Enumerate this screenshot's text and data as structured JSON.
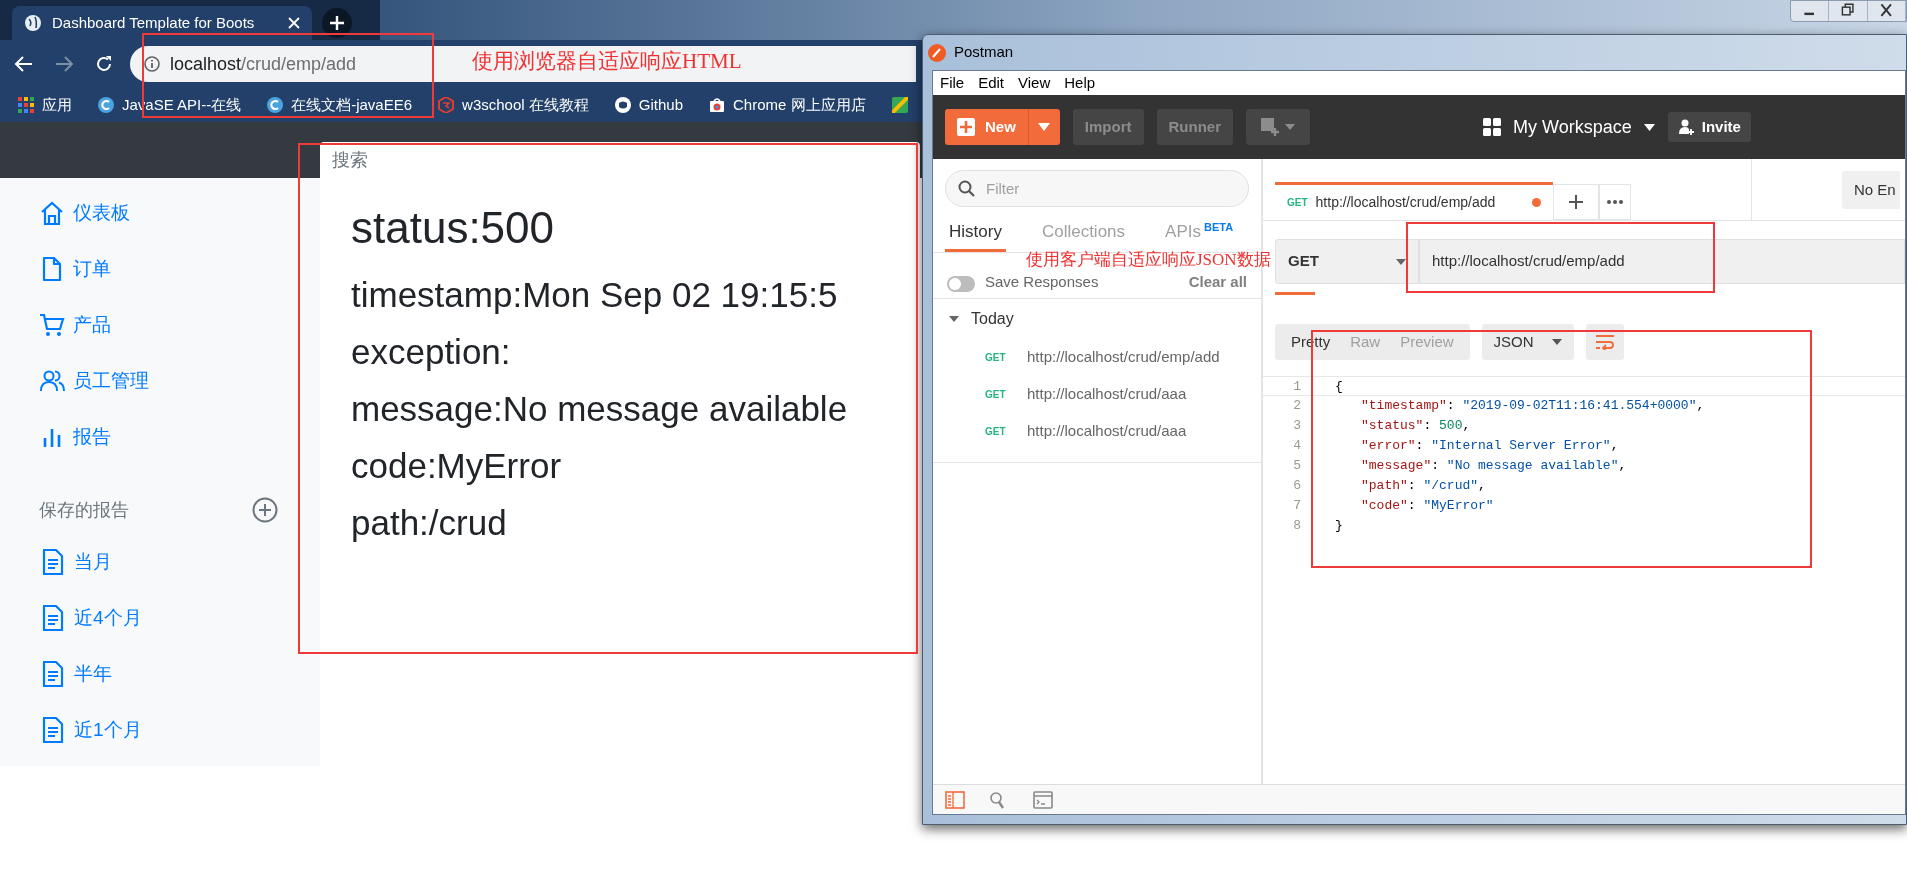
{
  "browser": {
    "tabs": [
      {
        "title": "Dashboard Template for Boots",
        "selected": true
      }
    ],
    "address": {
      "host": "localhost",
      "path": "/crud/emp/add"
    },
    "bookmarks": [
      {
        "label": "应用",
        "kind": "apps"
      },
      {
        "label": "JavaSE API--在线",
        "kind": "doc"
      },
      {
        "label": "在线文档-javaEE6",
        "kind": "doc"
      },
      {
        "label": "w3school 在线教程",
        "kind": "w3"
      },
      {
        "label": "Github",
        "kind": "github"
      },
      {
        "label": "Chrome 网上应用店",
        "kind": "store"
      }
    ]
  },
  "page": {
    "search": {
      "placeholder": "搜索"
    },
    "nav": [
      {
        "label": "仪表板",
        "kind": "home"
      },
      {
        "label": "订单",
        "kind": "file"
      },
      {
        "label": "产品",
        "kind": "cart"
      },
      {
        "label": "员工管理",
        "kind": "users"
      },
      {
        "label": "报告",
        "kind": "bars"
      }
    ],
    "saved_reports": {
      "title": "保存的报告",
      "items": [
        "当月",
        "近4个月",
        "半年",
        "近1个月"
      ]
    },
    "error": [
      {
        "text": "status:500",
        "kind": "heading"
      },
      {
        "text": "timestamp:Mon Sep 02 19:15:5",
        "kind": "line"
      },
      {
        "text": "exception:",
        "kind": "line"
      },
      {
        "text": "message:No message available",
        "kind": "line"
      },
      {
        "text": "code:MyError",
        "kind": "line"
      },
      {
        "text": "path:/crud",
        "kind": "line"
      }
    ]
  },
  "postman": {
    "title": "Postman",
    "menu": [
      "File",
      "Edit",
      "View",
      "Help"
    ],
    "toolbar": {
      "new": "New",
      "import": "Import",
      "runner": "Runner",
      "workspace": "My Workspace",
      "invite": "Invite"
    },
    "sidebar": {
      "filter_placeholder": "Filter",
      "tabs": [
        {
          "label": "History",
          "selected": true
        },
        {
          "label": "Collections",
          "selected": false
        },
        {
          "label": "APIs",
          "badge": "BETA",
          "selected": false
        }
      ],
      "save_responses": {
        "label": "Save Responses",
        "on": false
      },
      "clear_all": "Clear all",
      "groups": [
        {
          "label": "Today",
          "expanded": true,
          "items": [
            {
              "method": "GET",
              "url": "http://localhost/crud/emp/add"
            },
            {
              "method": "GET",
              "url": "http://localhost/crud/aaa"
            },
            {
              "method": "GET",
              "url": "http://localhost/crud/aaa"
            }
          ]
        }
      ]
    },
    "request_tabs": [
      {
        "method": "GET",
        "url": "http://localhost/crud/emp/add",
        "selected": true,
        "unsaved": true
      }
    ],
    "environment": "No En",
    "request": {
      "method": "GET",
      "url": "http://localhost/crud/emp/add"
    },
    "response": {
      "views": [
        {
          "label": "Pretty",
          "selected": true
        },
        {
          "label": "Raw",
          "selected": false
        },
        {
          "label": "Preview",
          "selected": false
        }
      ],
      "format": "JSON",
      "lines": [
        {
          "number": "1",
          "tokens": [
            {
              "kind": "punct",
              "text": "{"
            }
          ]
        },
        {
          "number": "2",
          "tokens": [
            {
              "kind": "key",
              "text": "\"timestamp\""
            },
            {
              "kind": "punct",
              "text": ": "
            },
            {
              "kind": "string",
              "text": "\"2019-09-02T11:16:41.554+0000\""
            },
            {
              "kind": "punct",
              "text": ","
            }
          ]
        },
        {
          "number": "3",
          "tokens": [
            {
              "kind": "key",
              "text": "\"status\""
            },
            {
              "kind": "punct",
              "text": ": "
            },
            {
              "kind": "number",
              "text": "500"
            },
            {
              "kind": "punct",
              "text": ","
            }
          ]
        },
        {
          "number": "4",
          "tokens": [
            {
              "kind": "key",
              "text": "\"error\""
            },
            {
              "kind": "punct",
              "text": ": "
            },
            {
              "kind": "string",
              "text": "\"Internal Server Error\""
            },
            {
              "kind": "punct",
              "text": ","
            }
          ]
        },
        {
          "number": "5",
          "tokens": [
            {
              "kind": "key",
              "text": "\"message\""
            },
            {
              "kind": "punct",
              "text": ": "
            },
            {
              "kind": "string",
              "text": "\"No message available\""
            },
            {
              "kind": "punct",
              "text": ","
            }
          ]
        },
        {
          "number": "6",
          "tokens": [
            {
              "kind": "key",
              "text": "\"path\""
            },
            {
              "kind": "punct",
              "text": ": "
            },
            {
              "kind": "string",
              "text": "\"/crud\""
            },
            {
              "kind": "punct",
              "text": ","
            }
          ]
        },
        {
          "number": "7",
          "tokens": [
            {
              "kind": "key",
              "text": "\"code\""
            },
            {
              "kind": "punct",
              "text": ": "
            },
            {
              "kind": "string",
              "text": "\"MyError\""
            }
          ]
        },
        {
          "number": "8",
          "tokens": [
            {
              "kind": "punct",
              "text": "}"
            }
          ]
        }
      ]
    },
    "status_bar": [
      {
        "kind": "sidebar",
        "selected": true
      },
      {
        "kind": "search",
        "selected": false
      },
      {
        "kind": "console",
        "selected": false
      }
    ]
  },
  "annotations": [
    {
      "text": "使用浏览器自适应响应HTML"
    },
    {
      "text": "使用客户端自适应响应JSON数据"
    }
  ]
}
